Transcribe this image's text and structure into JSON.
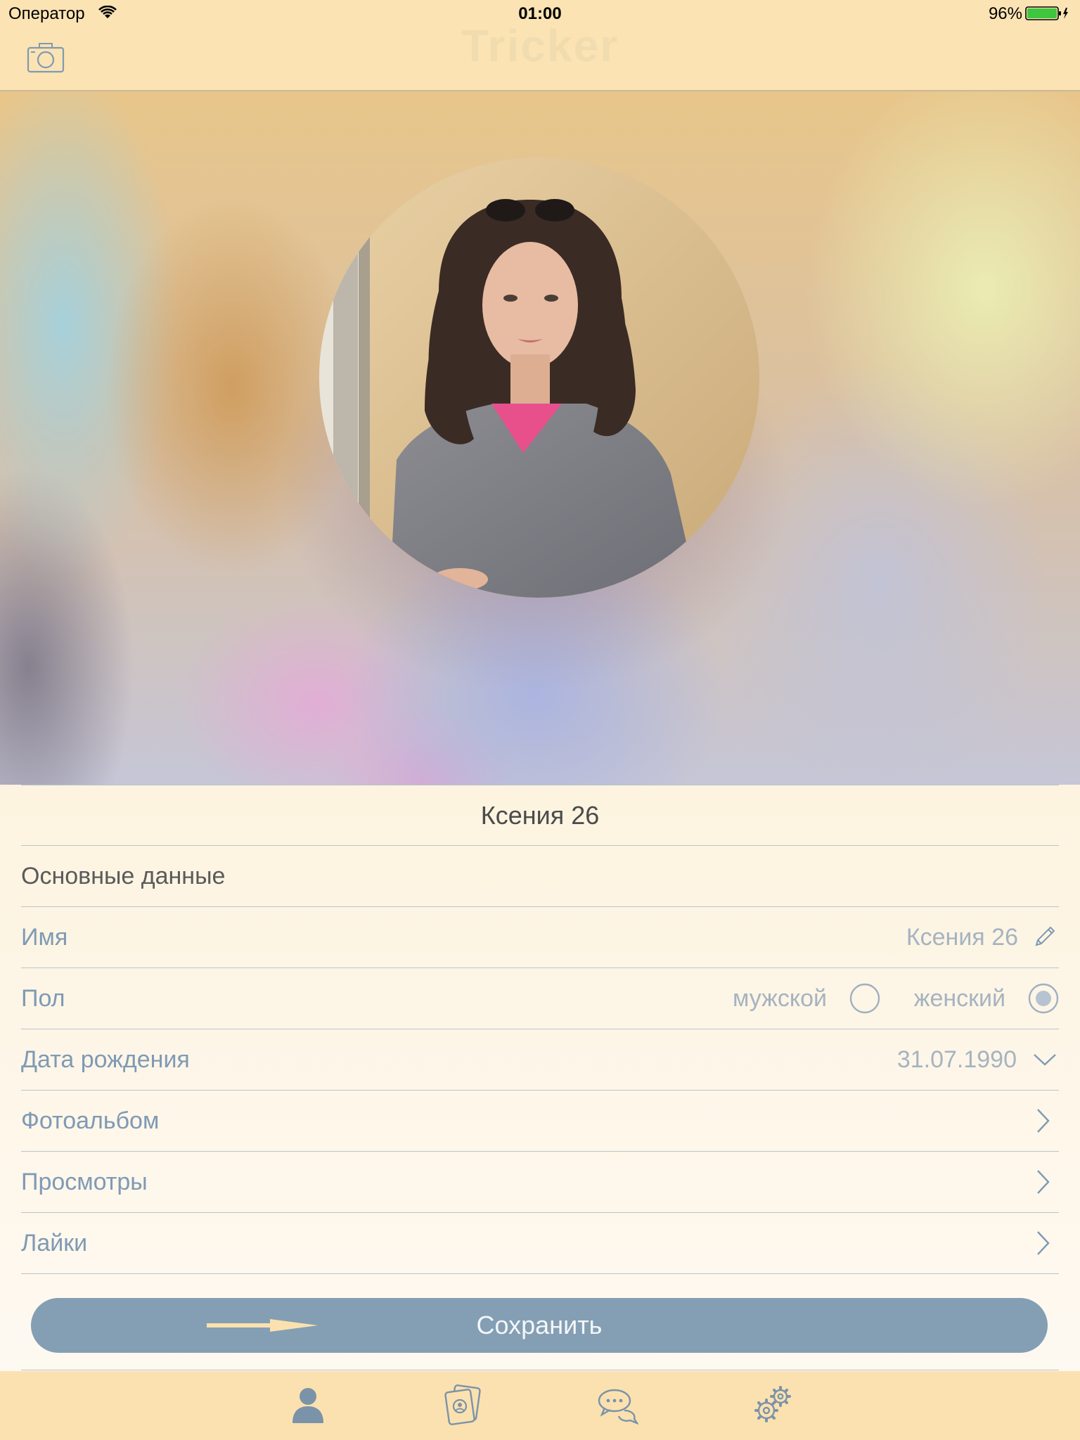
{
  "status_bar": {
    "carrier": "Оператор",
    "time": "01:00",
    "battery": "96%"
  },
  "nav_bar": {
    "title": "Tricker",
    "camera_icon": "camera-icon"
  },
  "profile": {
    "display_name": "Ксения 26"
  },
  "form": {
    "section_title": "Основные данные",
    "name": {
      "label": "Имя",
      "value": "Ксения 26"
    },
    "gender": {
      "label": "Пол",
      "male_label": "мужской",
      "female_label": "женский",
      "selected": "female"
    },
    "birth_date": {
      "label": "Дата рождения",
      "value": "31.07.1990"
    },
    "photo_album": {
      "label": "Фотоальбом"
    },
    "views": {
      "label": "Просмотры"
    },
    "likes": {
      "label": "Лайки"
    }
  },
  "save_button": {
    "label": "Сохранить"
  },
  "tab_bar": {
    "tabs": [
      {
        "icon": "person-icon",
        "active": true
      },
      {
        "icon": "cards-icon",
        "active": false
      },
      {
        "icon": "chat-bubbles-icon",
        "active": false
      },
      {
        "icon": "gears-icon",
        "active": false
      }
    ]
  },
  "colors": {
    "header_bg": "#fbe3b3",
    "accent": "#849fb4",
    "label": "#7f9ab4",
    "value": "#a6b3c0",
    "tab_icon": "#7b93a8"
  }
}
